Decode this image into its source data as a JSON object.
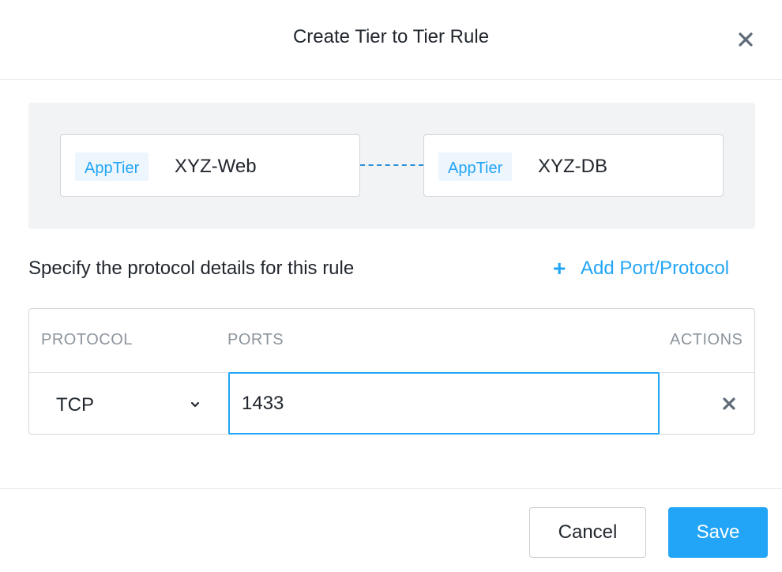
{
  "dialog": {
    "title": "Create Tier to Tier Rule"
  },
  "tiers": {
    "source": {
      "tag": "AppTier",
      "name": "XYZ-Web"
    },
    "destination": {
      "tag": "AppTier",
      "name": "XYZ-DB"
    }
  },
  "protocol_section": {
    "prompt": "Specify the protocol details for this rule",
    "add_link_icon": "+",
    "add_link_label": "Add Port/Protocol"
  },
  "table": {
    "headers": {
      "protocol": "PROTOCOL",
      "ports": "PORTS",
      "actions": "ACTIONS"
    },
    "rows": [
      {
        "protocol": "TCP",
        "ports": "1433"
      }
    ]
  },
  "footer": {
    "cancel_label": "Cancel",
    "save_label": "Save"
  },
  "colors": {
    "accent": "#22a5f7",
    "tag_bg": "#eef6fd",
    "panel_bg": "#f2f3f5",
    "icon_gray": "#5f6b78"
  },
  "icons": {
    "close": "close-icon",
    "chevron": "chevron-down-icon",
    "remove": "remove-row-icon",
    "add": "plus-icon"
  }
}
